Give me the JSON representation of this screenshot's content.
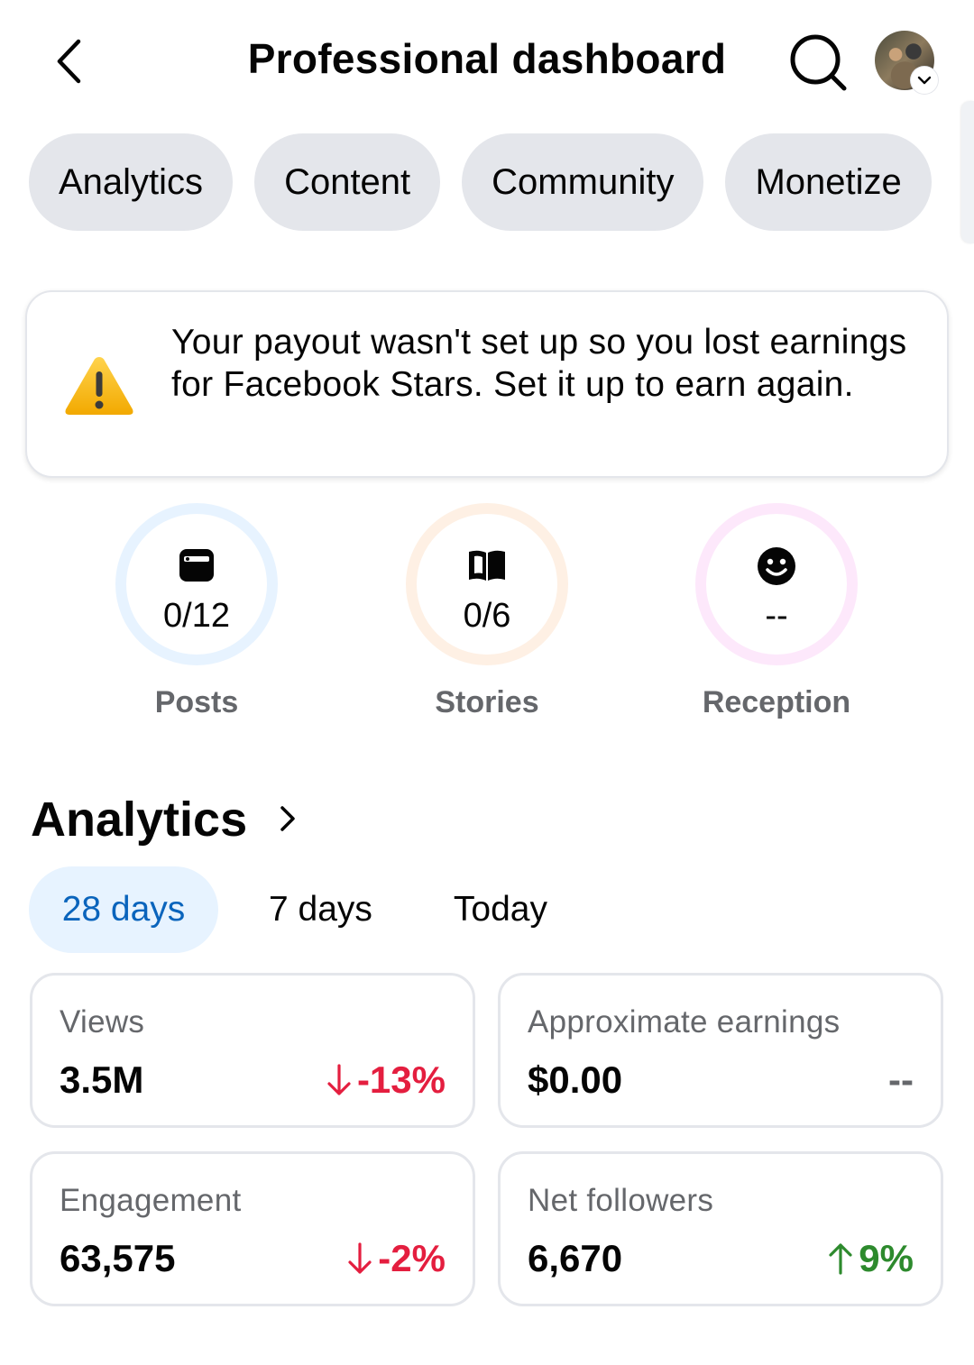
{
  "header": {
    "title": "Professional dashboard",
    "back_icon": "chevron-left-icon",
    "search_icon": "search-icon"
  },
  "tabs": [
    {
      "label": "Analytics"
    },
    {
      "label": "Content"
    },
    {
      "label": "Community"
    },
    {
      "label": "Monetize"
    }
  ],
  "warning": {
    "icon": "warning-icon",
    "text": "Your payout wasn't set up so you lost earnings for Facebook Stars. Set it up to earn again."
  },
  "stats": [
    {
      "label": "Posts",
      "value": "0/12",
      "icon": "post-icon",
      "ring_color": "#e7f3ff"
    },
    {
      "label": "Stories",
      "value": "0/6",
      "icon": "book-icon",
      "ring_color": "#fef0e4"
    },
    {
      "label": "Reception",
      "value": "--",
      "icon": "smiley-icon",
      "ring_color": "#fde8fb"
    }
  ],
  "analytics": {
    "title": "Analytics",
    "periods": [
      {
        "label": "28 days",
        "active": true
      },
      {
        "label": "7 days",
        "active": false
      },
      {
        "label": "Today",
        "active": false
      }
    ],
    "cards": [
      {
        "label": "Views",
        "value": "3.5M",
        "change": "-13%",
        "trend": "down"
      },
      {
        "label": "Approximate earnings",
        "value": "$0.00",
        "change": "--",
        "trend": "none"
      },
      {
        "label": "Engagement",
        "value": "63,575",
        "change": "-2%",
        "trend": "down"
      },
      {
        "label": "Net followers",
        "value": "6,670",
        "change": "9%",
        "trend": "up"
      }
    ]
  },
  "colors": {
    "accent_blue": "#0a64bc",
    "down_red": "#e41e3f",
    "up_green": "#2d8a2d",
    "pill_gray": "#e4e6eb"
  }
}
